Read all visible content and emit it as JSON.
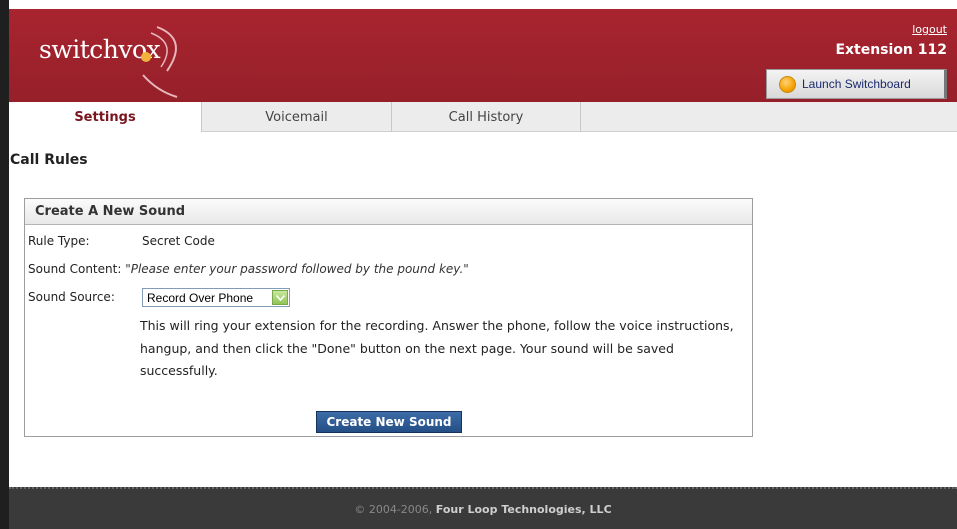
{
  "header": {
    "logo_text": "switchvox",
    "logout_label": "logout",
    "extension_label": "Extension 112",
    "launch_button_label": "Launch Switchboard",
    "brand_color": "#a8242f"
  },
  "tabs": [
    {
      "label": "Settings",
      "active": true
    },
    {
      "label": "Voicemail",
      "active": false
    },
    {
      "label": "Call History",
      "active": false
    }
  ],
  "page": {
    "title": "Call Rules"
  },
  "panel": {
    "title": "Create A New Sound",
    "rule_type_label": "Rule Type:",
    "rule_type_value": "Secret Code",
    "sound_content_label": "Sound Content:",
    "sound_content_value": "\"Please enter your password followed by the pound key.\"",
    "sound_source_label": "Sound Source:",
    "sound_source_selected": "Record Over Phone",
    "help_text": "This will ring your extension for the recording. Answer the phone, follow the voice instructions, hangup, and then click the \"Done\" button on the next page. Your sound will be saved successfully.",
    "create_button_label": "Create New Sound"
  },
  "footer": {
    "copyright": "© 2004-2006,",
    "company": "Four Loop Technologies, LLC"
  }
}
